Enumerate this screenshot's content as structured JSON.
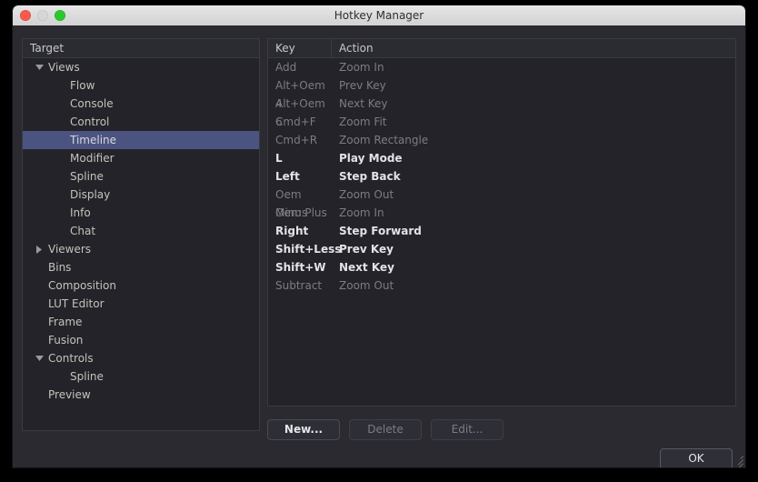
{
  "window": {
    "title": "Hotkey Manager",
    "traffic_lights": [
      "close-button",
      "minimize-button",
      "zoom-button"
    ]
  },
  "tree": {
    "header": "Target",
    "items": [
      {
        "label": "Views",
        "indent": 0,
        "arrow": "expanded",
        "selected": false
      },
      {
        "label": "Flow",
        "indent": 1,
        "arrow": "none",
        "selected": false
      },
      {
        "label": "Console",
        "indent": 1,
        "arrow": "none",
        "selected": false
      },
      {
        "label": "Control",
        "indent": 1,
        "arrow": "none",
        "selected": false
      },
      {
        "label": "Timeline",
        "indent": 1,
        "arrow": "none",
        "selected": true
      },
      {
        "label": "Modifier",
        "indent": 1,
        "arrow": "none",
        "selected": false
      },
      {
        "label": "Spline",
        "indent": 1,
        "arrow": "none",
        "selected": false
      },
      {
        "label": "Display",
        "indent": 1,
        "arrow": "none",
        "selected": false
      },
      {
        "label": "Info",
        "indent": 1,
        "arrow": "none",
        "selected": false
      },
      {
        "label": "Chat",
        "indent": 1,
        "arrow": "none",
        "selected": false
      },
      {
        "label": "Viewers",
        "indent": 0,
        "arrow": "collapsed",
        "selected": false
      },
      {
        "label": "Bins",
        "indent": 0,
        "arrow": "none",
        "selected": false
      },
      {
        "label": "Composition",
        "indent": 0,
        "arrow": "none",
        "selected": false
      },
      {
        "label": "LUT Editor",
        "indent": 0,
        "arrow": "none",
        "selected": false
      },
      {
        "label": "Frame",
        "indent": 0,
        "arrow": "none",
        "selected": false
      },
      {
        "label": "Fusion",
        "indent": 0,
        "arrow": "none",
        "selected": false
      },
      {
        "label": "Controls",
        "indent": 0,
        "arrow": "expanded",
        "selected": false
      },
      {
        "label": "Spline",
        "indent": 1,
        "arrow": "none",
        "selected": false
      },
      {
        "label": "Preview",
        "indent": 0,
        "arrow": "none",
        "selected": false
      }
    ]
  },
  "list": {
    "columns": [
      "Key",
      "Action"
    ],
    "rows": [
      {
        "key": "Add",
        "action": "Zoom In",
        "enabled": false
      },
      {
        "key": "Alt+Oem 4",
        "action": "Prev Key",
        "enabled": false
      },
      {
        "key": "Alt+Oem 6",
        "action": "Next Key",
        "enabled": false
      },
      {
        "key": "Cmd+F",
        "action": "Zoom Fit",
        "enabled": false
      },
      {
        "key": "Cmd+R",
        "action": "Zoom Rectangle",
        "enabled": false
      },
      {
        "key": "L",
        "action": "Play Mode",
        "enabled": true
      },
      {
        "key": "Left",
        "action": "Step Back",
        "enabled": true
      },
      {
        "key": "Oem Minus",
        "action": "Zoom Out",
        "enabled": false
      },
      {
        "key": "Oem Plus",
        "action": "Zoom In",
        "enabled": false
      },
      {
        "key": "Right",
        "action": "Step Forward",
        "enabled": true
      },
      {
        "key": "Shift+Less",
        "action": "Prev Key",
        "enabled": true
      },
      {
        "key": "Shift+W",
        "action": "Next Key",
        "enabled": true
      },
      {
        "key": "Subtract",
        "action": "Zoom Out",
        "enabled": false
      }
    ]
  },
  "buttons": {
    "new": "New...",
    "delete": "Delete",
    "edit": "Edit...",
    "ok": "OK"
  },
  "colors": {
    "window_background": "#2a2a30",
    "panel_background": "#232329",
    "panel_border": "#3a3a42",
    "selection": "#4b5480",
    "text_enabled": "#e3e3e6",
    "text_disabled": "#7c7c86",
    "tree_text": "#c6c2bb",
    "titlebar": "#dcdcdc",
    "close_dot": "#f9584f",
    "minimize_dot": "#d6d6d6",
    "zoom_dot": "#2cc72c"
  }
}
